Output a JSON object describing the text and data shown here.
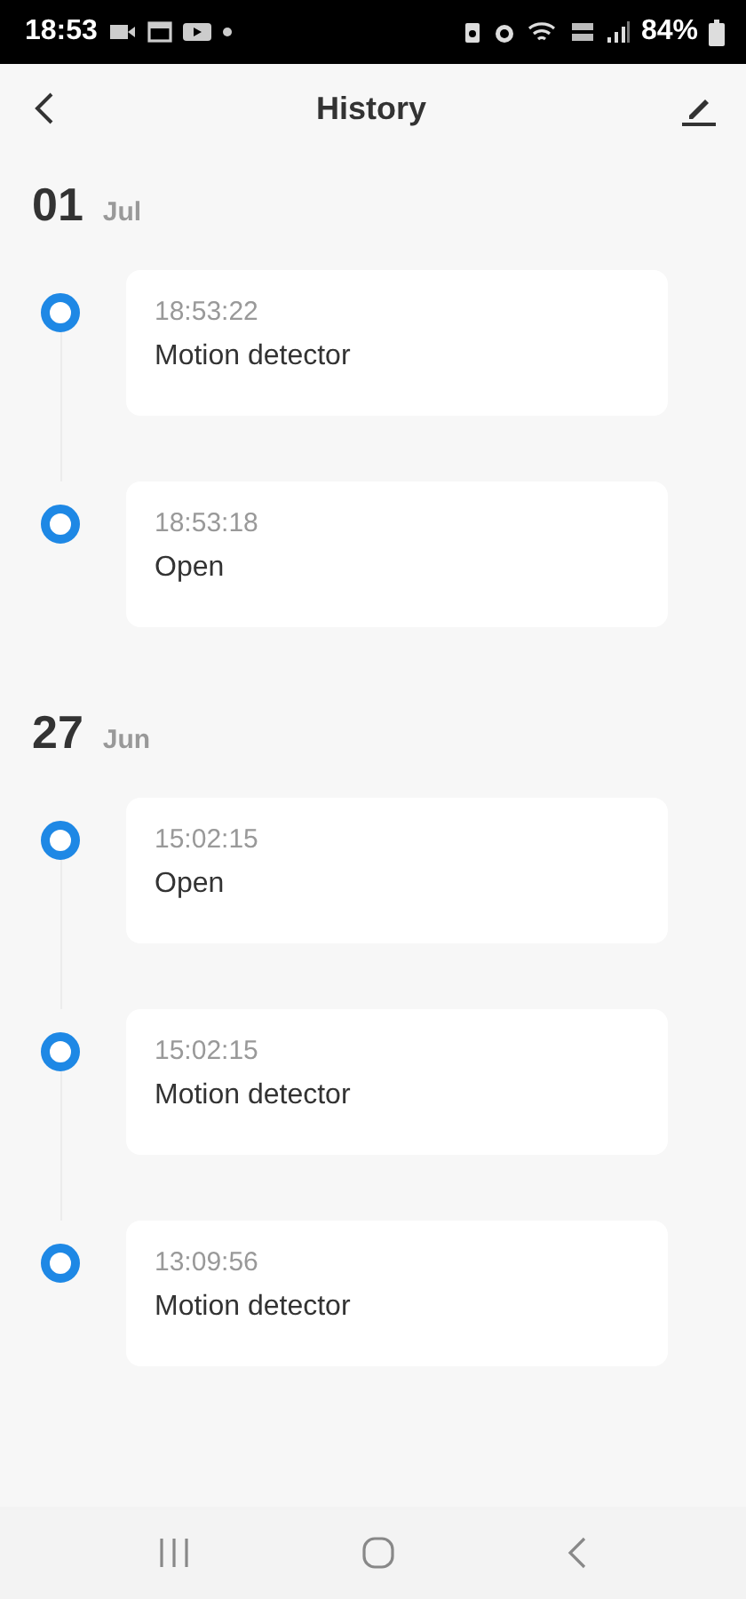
{
  "status_bar": {
    "time": "18:53",
    "battery": "84%"
  },
  "header": {
    "title": "History"
  },
  "groups": [
    {
      "day": "01",
      "month": "Jul",
      "events": [
        {
          "time": "18:53:22",
          "label": "Motion detector"
        },
        {
          "time": "18:53:18",
          "label": "Open"
        }
      ]
    },
    {
      "day": "27",
      "month": "Jun",
      "events": [
        {
          "time": "15:02:15",
          "label": "Open"
        },
        {
          "time": "15:02:15",
          "label": "Motion detector"
        },
        {
          "time": "13:09:56",
          "label": "Motion detector"
        }
      ]
    }
  ]
}
